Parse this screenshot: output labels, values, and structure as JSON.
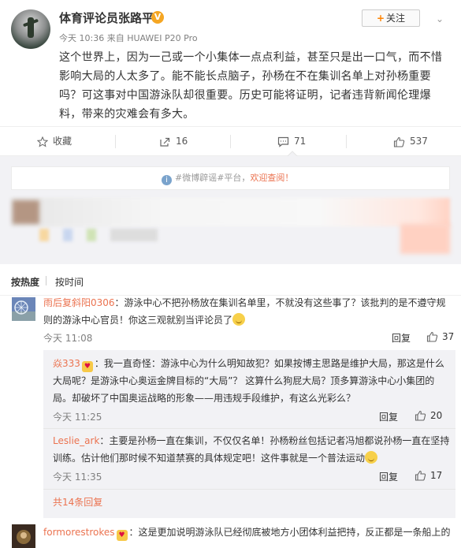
{
  "post": {
    "username": "体育评论员张路平",
    "verified_mark": "V",
    "meta": "今天 10:36 来自 HUAWEI P20 Pro",
    "follow_label": "关注",
    "text": "这个世界上，因为一己或一个小集体一点点利益，甚至只是出一口气，而不惜影响大局的人太多了。能不能长点脑子，孙杨在不在集训名单上对孙杨重要吗？可这事对中国游泳队却很重要。历史可能将证明，记者违背新闻伦理爆料，带来的灾难会有多大。"
  },
  "actions": {
    "favorite": "收藏",
    "forward": "16",
    "comment": "71",
    "like": "537"
  },
  "notice": {
    "text": "#微博辟谣#平台，",
    "link": "欢迎查阅！"
  },
  "sort": {
    "hot": "按热度",
    "time": "按时间"
  },
  "comments": [
    {
      "name": "雨后复斜阳0306",
      "text": "：游泳中心不把孙杨放在集训名单里，不就没有这些事了？该批判的是不遵守规则的游泳中心官员！你这三观就别当评论员了",
      "time": "今天 11:08",
      "reply": "回复",
      "likes": "37",
      "replies": [
        {
          "name": "焱333",
          "text": "：我一直奇怪：游泳中心为什么明知故犯？如果按博主思路是维护大局，那这是什么大局呢？是游泳中心奥运金牌目标的“大局”？ 这算什么狗屁大局？顶多算游泳中心小集团的局。却破坏了中国奥运战略的形象——用违规手段维护，有这么光彩么？",
          "time": "今天 11:25",
          "reply": "回复",
          "likes": "20"
        },
        {
          "name": "Leslie_ark",
          "text": "：主要是孙杨一直在集训，不仅仅名单！孙杨粉丝包括记者冯旭都说孙杨一直在坚持训练。估计他们那时候不知道禁赛的具体规定吧！这件事就是一个普法运动",
          "time": "今天 11:35",
          "reply": "回复",
          "likes": "17"
        }
      ],
      "total_replies": "共14条回复"
    },
    {
      "name": "formorestrokes",
      "text": "：这是更加说明游泳队已经彻底被地方小团体利益把持，反正都是一条船上的"
    }
  ],
  "colors": {
    "accent": "#eb7350",
    "follow_plus": "#ff8200",
    "gray_bg": "#f2f2f5"
  }
}
